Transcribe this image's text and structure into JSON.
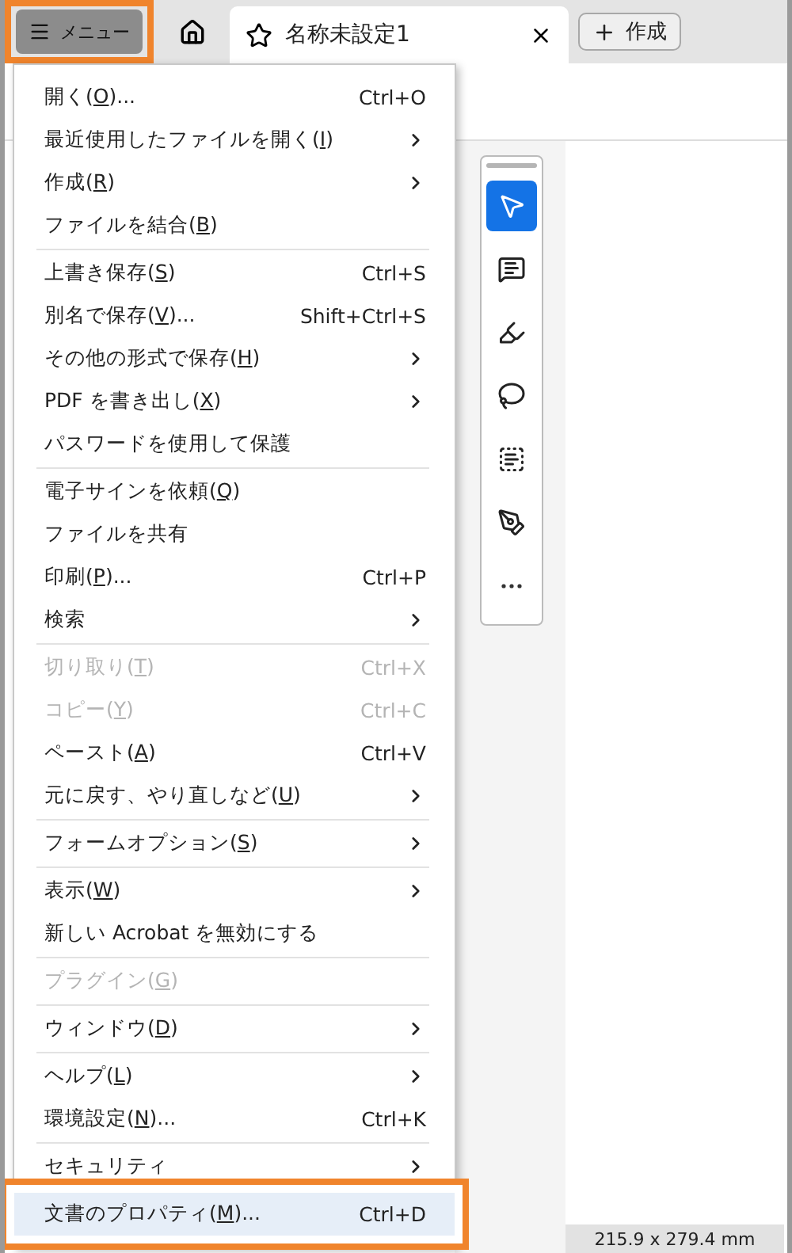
{
  "top_bar": {
    "menu_button": {
      "label": "メニュー",
      "annotated": true
    },
    "tab": {
      "title": "名称未設定1"
    },
    "create_button": {
      "label": "作成"
    }
  },
  "menu": {
    "groups": [
      [
        {
          "label": "開く(O)...",
          "shortcut": "Ctrl+O",
          "submenu": false,
          "disabled": false,
          "selected": false
        },
        {
          "label": "最近使用したファイルを開く(I)",
          "submenu": true,
          "disabled": false,
          "selected": false
        },
        {
          "label": "作成(R)",
          "submenu": true,
          "disabled": false,
          "selected": false
        },
        {
          "label": "ファイルを結合(B)",
          "submenu": false,
          "disabled": false,
          "selected": false
        }
      ],
      [
        {
          "label": "上書き保存(S)",
          "shortcut": "Ctrl+S",
          "submenu": false,
          "disabled": false,
          "selected": false
        },
        {
          "label": "別名で保存(V)...",
          "shortcut": "Shift+Ctrl+S",
          "submenu": false,
          "disabled": false,
          "selected": false
        },
        {
          "label": "その他の形式で保存(H)",
          "submenu": true,
          "disabled": false,
          "selected": false
        },
        {
          "label": "PDF を書き出し(X)",
          "submenu": true,
          "disabled": false,
          "selected": false
        },
        {
          "label": "パスワードを使用して保護",
          "submenu": false,
          "disabled": false,
          "selected": false
        }
      ],
      [
        {
          "label": "電子サインを依頼(Q)",
          "submenu": false,
          "disabled": false,
          "selected": false
        },
        {
          "label": "ファイルを共有",
          "submenu": false,
          "disabled": false,
          "selected": false
        },
        {
          "label": "印刷(P)...",
          "shortcut": "Ctrl+P",
          "submenu": false,
          "disabled": false,
          "selected": false
        },
        {
          "label": "検索",
          "submenu": true,
          "disabled": false,
          "selected": false
        }
      ],
      [
        {
          "label": "切り取り(T)",
          "shortcut": "Ctrl+X",
          "submenu": false,
          "disabled": true,
          "selected": false
        },
        {
          "label": "コピー(Y)",
          "shortcut": "Ctrl+C",
          "submenu": false,
          "disabled": true,
          "selected": false
        },
        {
          "label": "ペースト(A)",
          "shortcut": "Ctrl+V",
          "submenu": false,
          "disabled": false,
          "selected": false
        },
        {
          "label": "元に戻す、やり直しなど(U)",
          "submenu": true,
          "disabled": false,
          "selected": false
        }
      ],
      [
        {
          "label": "フォームオプション(S)",
          "submenu": true,
          "disabled": false,
          "selected": false
        }
      ],
      [
        {
          "label": "表示(W)",
          "submenu": true,
          "disabled": false,
          "selected": false
        },
        {
          "label": "新しい Acrobat を無効にする",
          "submenu": false,
          "disabled": false,
          "selected": false
        }
      ],
      [
        {
          "label": "プラグイン(G)",
          "submenu": false,
          "disabled": true,
          "selected": false
        }
      ],
      [
        {
          "label": "ウィンドウ(D)",
          "submenu": true,
          "disabled": false,
          "selected": false
        }
      ],
      [
        {
          "label": "ヘルプ(L)",
          "submenu": true,
          "disabled": false,
          "selected": false
        },
        {
          "label": "環境設定(N)...",
          "shortcut": "Ctrl+K",
          "submenu": false,
          "disabled": false,
          "selected": false
        }
      ],
      [
        {
          "label": "セキュリティ",
          "submenu": true,
          "disabled": false,
          "selected": false
        }
      ],
      [
        {
          "label": "文書のプロパティ(M)...",
          "shortcut": "Ctrl+D",
          "submenu": false,
          "disabled": false,
          "selected": true,
          "annotated": true
        }
      ]
    ]
  },
  "tools": [
    {
      "kind": "select",
      "selected": true
    },
    {
      "kind": "comment",
      "selected": false
    },
    {
      "kind": "highlight",
      "selected": false
    },
    {
      "kind": "draw",
      "selected": false
    },
    {
      "kind": "text",
      "selected": false
    },
    {
      "kind": "sign",
      "selected": false
    },
    {
      "kind": "more",
      "selected": false
    }
  ],
  "status_bar": {
    "page_size": "215.9 x 279.4 mm"
  }
}
